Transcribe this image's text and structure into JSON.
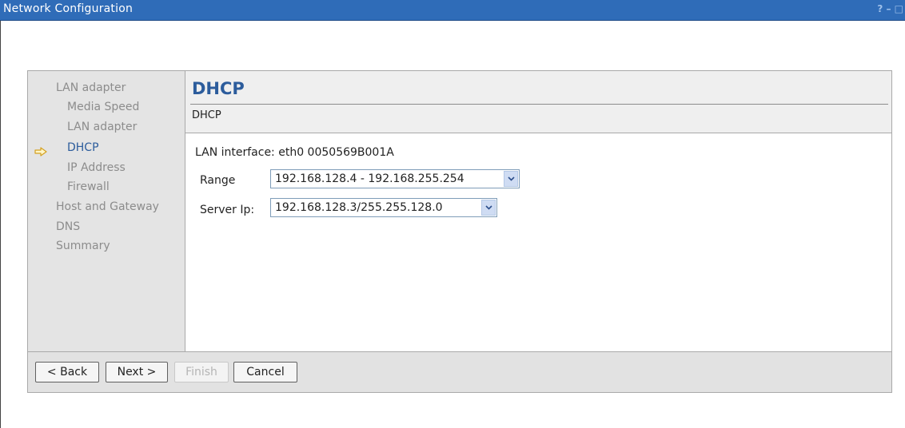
{
  "window": {
    "title": "Network Configuration",
    "controls": "? – □"
  },
  "nav": {
    "items": [
      {
        "label": "LAN adapter",
        "active": false
      },
      {
        "label": "Media Speed",
        "active": false
      },
      {
        "label": "LAN adapter",
        "active": false
      },
      {
        "label": "DHCP",
        "active": true
      },
      {
        "label": "IP Address",
        "active": false
      },
      {
        "label": "Firewall",
        "active": false
      },
      {
        "label": "Host and Gateway",
        "active": false
      },
      {
        "label": "DNS",
        "active": false
      },
      {
        "label": "Summary",
        "active": false
      }
    ]
  },
  "content": {
    "title": "DHCP",
    "subtitle": "DHCP",
    "lan_interface": "LAN interface: eth0 0050569B001A",
    "range": {
      "label": "Range",
      "value": "192.168.128.4 - 192.168.255.254"
    },
    "server_ip": {
      "label": "Server Ip:",
      "value": "192.168.128.3/255.255.128.0"
    }
  },
  "footer": {
    "back": "< Back",
    "next": "Next >",
    "finish": "Finish",
    "cancel": "Cancel"
  },
  "colors": {
    "titlebar": "#2f6cb8",
    "accent": "#2c5c9c"
  }
}
